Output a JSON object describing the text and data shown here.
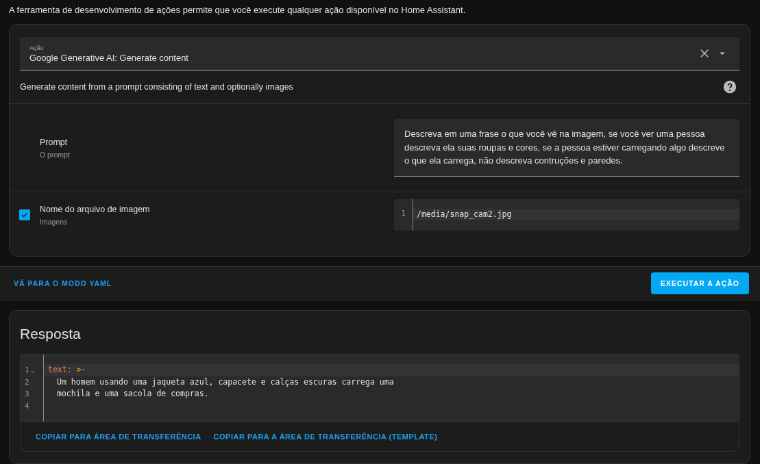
{
  "intro": "A ferramenta de desenvolvimento de ações permite que você execute qualquer ação disponível no Home Assistant.",
  "action_picker": {
    "label": "Ação",
    "value": "Google Generative AI: Generate content"
  },
  "description": "Generate content from a prompt consisting of text and optionally images",
  "fields": [
    {
      "kind": "textarea",
      "name": "Prompt",
      "hint": "O prompt",
      "has_checkbox": false,
      "value": "Descreva em uma frase o que você vê na imagem, se você ver uma pessoa descreva ela suas roupas e cores, se a pessoa estiver carregando algo descreve o que ela carrega, não descreva contruções e paredes."
    },
    {
      "kind": "code",
      "name": "Nome do arquivo de imagem",
      "hint": "Imagens",
      "has_checkbox": true,
      "checked": true,
      "lines": [
        {
          "number": "1",
          "text": "/media/snap_cam2.jpg"
        }
      ]
    }
  ],
  "actions": {
    "yaml_link": "VÁ PARA O MODO YAML",
    "run_button": "EXECUTAR A AÇÃO"
  },
  "response": {
    "title": "Resposta",
    "lines": [
      {
        "kind": "keyval",
        "number": "1",
        "foldable": true,
        "key": "text:",
        "value": ">-"
      },
      {
        "kind": "text",
        "number": "2",
        "foldable": false,
        "text": "Um homem usando uma jaqueta azul, capacete e calças escuras carrega uma"
      },
      {
        "kind": "text",
        "number": "3",
        "foldable": false,
        "text": "mochila e uma sacola de compras."
      },
      {
        "kind": "empty",
        "number": "4",
        "foldable": false
      }
    ],
    "buttons": [
      "COPIAR PARA ÁREA DE TRANSFERÊNCIA",
      "COPIAR PARA A ÁREA DE TRANSFERÊNCIA (TEMPLATE)"
    ]
  }
}
